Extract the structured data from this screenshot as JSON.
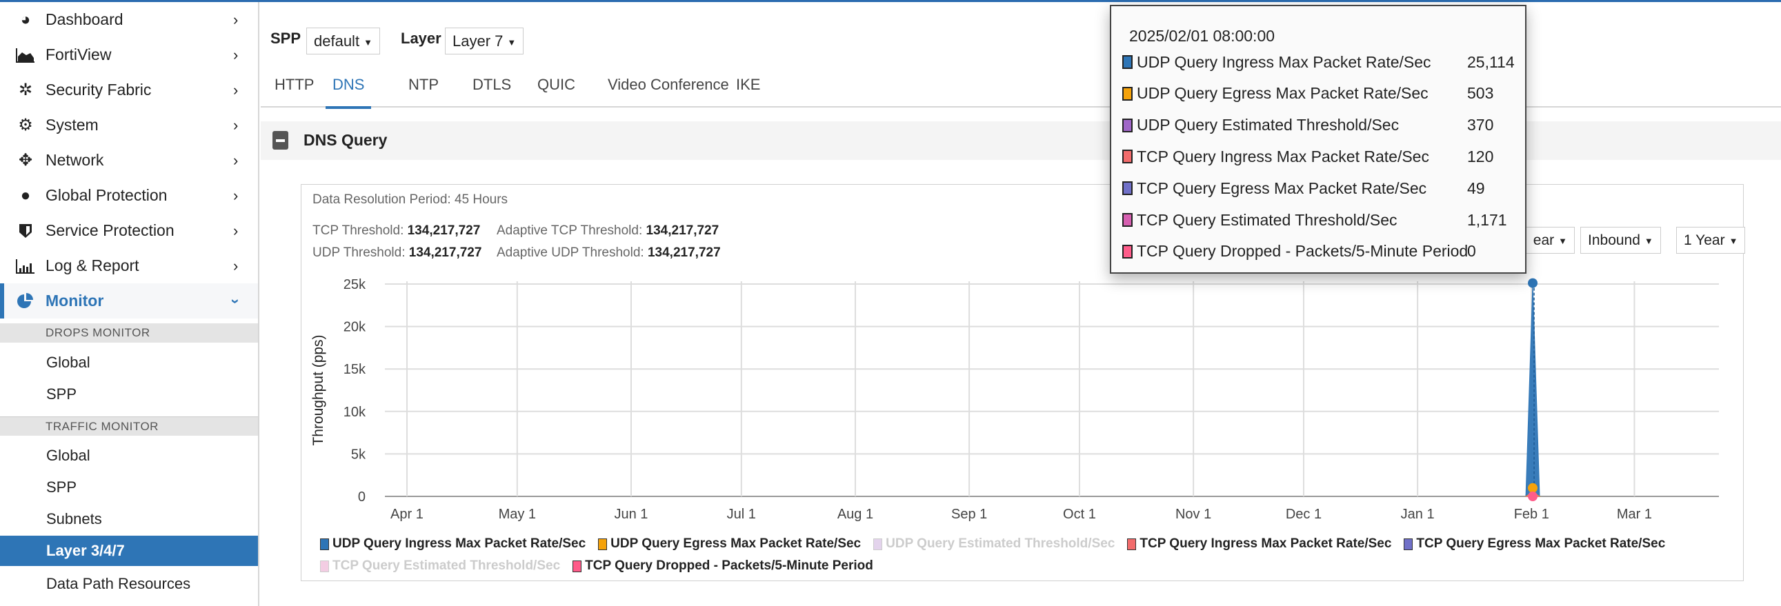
{
  "sidebar": {
    "items": [
      {
        "label": "Dashboard",
        "icon": "dashboard-icon"
      },
      {
        "label": "FortiView",
        "icon": "area-chart-icon"
      },
      {
        "label": "Security Fabric",
        "icon": "security-fabric-icon"
      },
      {
        "label": "System",
        "icon": "gear-icon"
      },
      {
        "label": "Network",
        "icon": "arrows-icon"
      },
      {
        "label": "Global Protection",
        "icon": "globe-icon"
      },
      {
        "label": "Service Protection",
        "icon": "shield-icon"
      },
      {
        "label": "Log & Report",
        "icon": "bar-chart-icon"
      },
      {
        "label": "Monitor",
        "icon": "pie-chart-icon"
      }
    ],
    "groups": [
      {
        "title": "DROPS MONITOR",
        "items": [
          "Global",
          "SPP"
        ]
      },
      {
        "title": "TRAFFIC MONITOR",
        "items": [
          "Global",
          "SPP",
          "Subnets",
          "Layer 3/4/7",
          "Data Path Resources"
        ]
      }
    ]
  },
  "filters": {
    "spp_label": "SPP",
    "spp_value": "default",
    "layer_label": "Layer",
    "layer_value": "Layer 7"
  },
  "tabs": [
    "HTTP",
    "DNS",
    "NTP",
    "DTLS",
    "QUIC",
    "Video Conference",
    "IKE"
  ],
  "active_tab": "DNS",
  "section_title": "DNS Query",
  "info": {
    "resolution": "Data Resolution Period: 45 Hours",
    "tcp_threshold_label": "TCP Threshold:",
    "tcp_threshold": "134,217,727",
    "adaptive_tcp_label": "Adaptive TCP Threshold:",
    "adaptive_tcp": "134,217,727",
    "udp_threshold_label": "UDP Threshold:",
    "udp_threshold": "134,217,727",
    "adaptive_udp_label": "Adaptive UDP Threshold:",
    "adaptive_udp": "134,217,727"
  },
  "controls": {
    "period_partial": "ear",
    "direction": "Inbound",
    "range": "1 Year"
  },
  "tooltip": {
    "date": "2025/02/01 08:00:00",
    "rows": [
      {
        "label": "UDP Query Ingress Max Packet Rate/Sec",
        "value": "25,114",
        "color": "#2e75b6"
      },
      {
        "label": "UDP Query Egress Max Packet Rate/Sec",
        "value": "503",
        "color": "#f5a20a"
      },
      {
        "label": "UDP Query Estimated Threshold/Sec",
        "value": "370",
        "color": "#a066c8"
      },
      {
        "label": "TCP Query Ingress Max Packet Rate/Sec",
        "value": "120",
        "color": "#f26b6b"
      },
      {
        "label": "TCP Query Egress Max Packet Rate/Sec",
        "value": "49",
        "color": "#7070c8"
      },
      {
        "label": "TCP Query Estimated Threshold/Sec",
        "value": "1,171",
        "color": "#d65fb0"
      },
      {
        "label": "TCP Query Dropped - Packets/5-Minute Period",
        "value": "0",
        "color": "#ff5c8a"
      }
    ]
  },
  "chart_data": {
    "type": "area",
    "ylabel": "Throughput (pps)",
    "ylim": [
      0,
      25000
    ],
    "yticks": [
      0,
      5000,
      10000,
      15000,
      20000,
      25000
    ],
    "ytick_labels": [
      "0",
      "5k",
      "10k",
      "15k",
      "20k",
      "25k"
    ],
    "xticks": [
      "2024-04-01",
      "2024-05-01",
      "2024-06-01",
      "2024-07-01",
      "2024-08-01",
      "2024-09-01",
      "2024-10-01",
      "2024-11-01",
      "2024-12-01",
      "2025-01-01",
      "2025-02-01",
      "2025-03-01"
    ],
    "xtick_labels": [
      "Apr 1",
      "May 1",
      "Jun 1",
      "Jul 1",
      "Aug 1",
      "Sep 1",
      "Oct 1",
      "Nov 1",
      "Dec 1",
      "Jan 1",
      "Feb 1",
      "Mar 1"
    ],
    "xlim": [
      "2024-03-26",
      "2025-03-24"
    ],
    "x": [
      "2025-01-30T11:00",
      "2025-02-01T08:00",
      "2025-02-03T05:00"
    ],
    "series": [
      {
        "name": "UDP Query Ingress Max Packet Rate/Sec",
        "color": "#2e75b6",
        "values": [
          0,
          25114,
          0
        ],
        "visible": true
      },
      {
        "name": "UDP Query Egress Max Packet Rate/Sec",
        "color": "#f5a20a",
        "values": [
          0,
          503,
          0
        ],
        "visible": true
      },
      {
        "name": "UDP Query Estimated Threshold/Sec",
        "color": "#e3d3ec",
        "values": [
          0,
          370,
          0
        ],
        "visible": false
      },
      {
        "name": "TCP Query Ingress Max Packet Rate/Sec",
        "color": "#f26b6b",
        "values": [
          0,
          120,
          0
        ],
        "visible": true
      },
      {
        "name": "TCP Query Egress Max Packet Rate/Sec",
        "color": "#7070c8",
        "values": [
          200,
          49,
          0
        ],
        "visible": true
      },
      {
        "name": "TCP Query Estimated Threshold/Sec",
        "color": "#f3cde3",
        "values": [
          0,
          1171,
          0
        ],
        "visible": false
      },
      {
        "name": "TCP Query Dropped - Packets/5-Minute Period",
        "color": "#ff5c8a",
        "values": [
          0,
          0,
          0
        ],
        "visible": true
      }
    ]
  }
}
